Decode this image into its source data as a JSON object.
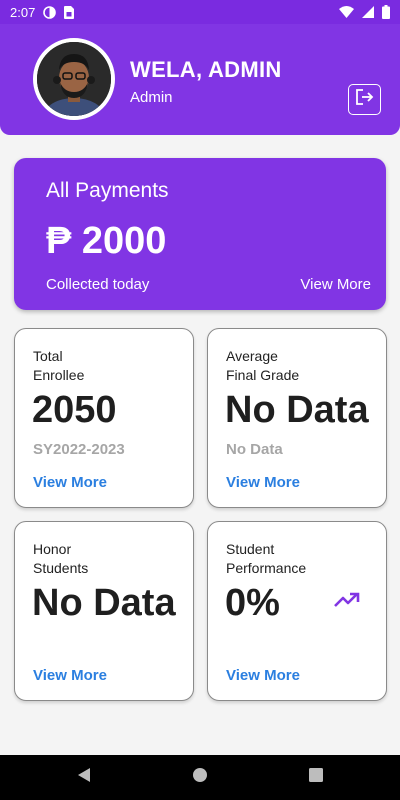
{
  "status_bar": {
    "time": "2:07",
    "icons": [
      "sync-icon",
      "sim-card-icon",
      "wifi-icon",
      "signal-icon",
      "battery-icon"
    ]
  },
  "header": {
    "name": "WELA, ADMIN",
    "role": "Admin",
    "avatar": "avatar",
    "logout_icon": "logout-icon"
  },
  "payments": {
    "title": "All Payments",
    "amount": "₱ 2000",
    "subtitle": "Collected today",
    "link": "View More"
  },
  "cards": [
    {
      "label_line1": "Total",
      "label_line2": "Enrollee",
      "value": "2050",
      "sub": "SY2022-2023",
      "link": "View More"
    },
    {
      "label_line1": "Average",
      "label_line2": "Final Grade",
      "value": "No Data",
      "sub": "No Data",
      "link": "View More"
    },
    {
      "label_line1": "Honor",
      "label_line2": "Students",
      "value": "No Data",
      "sub": "",
      "link": "View More"
    },
    {
      "label_line1": "Student",
      "label_line2": "Performance",
      "value": "0%",
      "sub": "",
      "link": "View More",
      "icon": "trending-up-icon"
    }
  ],
  "nav": [
    "back-icon",
    "home-icon",
    "recents-icon"
  ],
  "colors": {
    "primary": "#8135e4",
    "link": "#2b7fe0",
    "muted": "#a6a6a6"
  }
}
